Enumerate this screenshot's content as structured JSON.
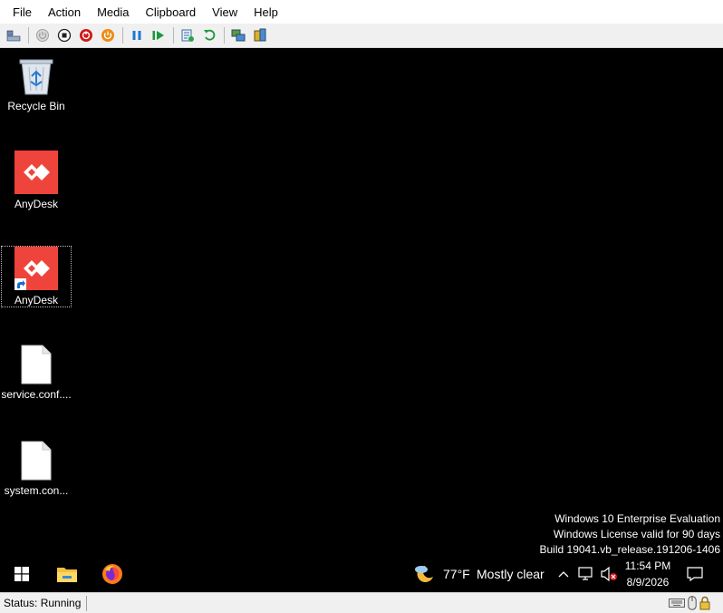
{
  "menubar": {
    "items": [
      "File",
      "Action",
      "Media",
      "Clipboard",
      "View",
      "Help"
    ]
  },
  "toolbar": {
    "buttons": [
      {
        "name": "ctrl-alt-del-icon"
      },
      {
        "name": "start-icon"
      },
      {
        "name": "turn-off-icon"
      },
      {
        "name": "shut-down-icon"
      },
      {
        "name": "power-icon"
      },
      {
        "name": "pause-icon"
      },
      {
        "name": "resume-icon"
      },
      {
        "name": "checkpoint-icon"
      },
      {
        "name": "revert-icon"
      },
      {
        "name": "enhanced-session-icon"
      },
      {
        "name": "share-icon"
      }
    ]
  },
  "desktop": {
    "icons": [
      {
        "label": "Recycle Bin",
        "icon": "recycle-bin-icon"
      },
      {
        "label": "AnyDesk",
        "icon": "anydesk-icon"
      },
      {
        "label": "AnyDesk",
        "icon": "anydesk-shortcut-icon"
      },
      {
        "label": "service.conf....",
        "icon": "file-icon"
      },
      {
        "label": "system.con...",
        "icon": "file-icon"
      }
    ],
    "watermark": {
      "line1": "Windows 10 Enterprise Evaluation",
      "line2": "Windows License valid for 90 days",
      "line3": "Build 19041.vb_release.191206-1406"
    }
  },
  "taskbar": {
    "weather": {
      "temp": "77°F",
      "condition": "Mostly clear"
    },
    "clock": {
      "time": "11:54 PM",
      "date": "8/9/2026"
    }
  },
  "statusbar": {
    "status": "Status: Running"
  },
  "colors": {
    "anydesk": "#ef443b",
    "desktop_bg": "#000000",
    "toolbar_bg": "#f0f0f0"
  }
}
